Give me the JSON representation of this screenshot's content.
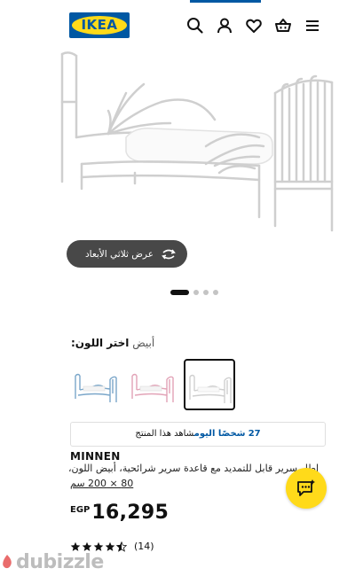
{
  "header": {
    "logo_text": "IKEA",
    "brand_blue": "#0058a3",
    "brand_yellow": "#ffda1a",
    "icons": [
      "search-icon",
      "user-icon",
      "heart-icon",
      "basket-icon",
      "menu-icon"
    ]
  },
  "gallery": {
    "view_3d_label": "عرض ثلاثي الأبعاد",
    "dots_count": 4,
    "active_index": 0
  },
  "color_picker": {
    "title": "اختر اللون:",
    "selected_value": "أبيض",
    "swatches": [
      {
        "name": "white",
        "selected": true
      },
      {
        "name": "pink",
        "selected": false
      },
      {
        "name": "blue",
        "selected": false
      }
    ]
  },
  "viewers_banner": {
    "count": "27",
    "text_after_count": "شخصًا اليوم",
    "text_end": "شاهد هذا المنتج"
  },
  "product": {
    "name": "MINNEN",
    "description": "إطار سرير قابل للتمديد مع قاعدة سرير شرائحية، أبيض اللون،",
    "size": "80 × 200 سم",
    "currency": "EGP",
    "price": "16,295",
    "rating": 4.5,
    "reviews": "(14)"
  },
  "watermark": {
    "text": "dubizzle"
  }
}
